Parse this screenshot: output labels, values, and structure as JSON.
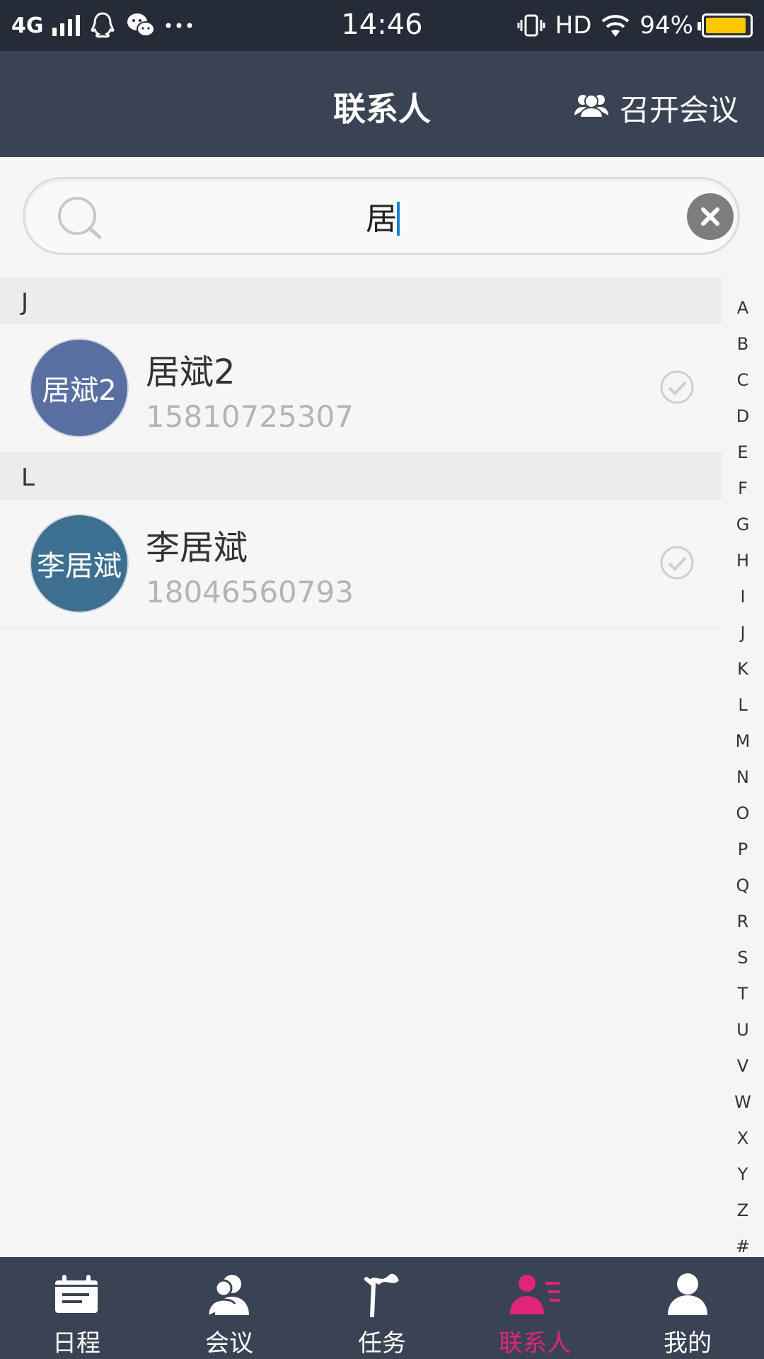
{
  "status_bar": {
    "network": "4G",
    "time": "14:46",
    "hd": "HD",
    "battery": "94%",
    "battery_level": 0.94,
    "battery_color": "#ffc800"
  },
  "nav": {
    "title": "联系人",
    "action_label": "召开会议",
    "action_icon": "group-icon"
  },
  "search": {
    "value": "居",
    "placeholder": ""
  },
  "sections": [
    {
      "letter": "J",
      "contacts": [
        {
          "avatar_text": "居斌2",
          "avatar_color": "#5a6fa1",
          "name": "居斌2",
          "phone": "15810725307"
        }
      ]
    },
    {
      "letter": "L",
      "contacts": [
        {
          "avatar_text": "李居斌",
          "avatar_color": "#3d6f91",
          "name": "李居斌",
          "phone": "18046560793"
        }
      ]
    }
  ],
  "alphabet": [
    "A",
    "B",
    "C",
    "D",
    "E",
    "F",
    "G",
    "H",
    "I",
    "J",
    "K",
    "L",
    "M",
    "N",
    "O",
    "P",
    "Q",
    "R",
    "S",
    "T",
    "U",
    "V",
    "W",
    "X",
    "Y",
    "Z",
    "#"
  ],
  "tabs": [
    {
      "label": "日程",
      "icon": "calendar-icon",
      "active": false
    },
    {
      "label": "会议",
      "icon": "meeting-icon",
      "active": false
    },
    {
      "label": "任务",
      "icon": "flag-icon",
      "active": false
    },
    {
      "label": "联系人",
      "icon": "contacts-icon",
      "active": true
    },
    {
      "label": "我的",
      "icon": "person-icon",
      "active": false
    }
  ],
  "colors": {
    "nav_bg": "#394353",
    "status_bg": "#262c37",
    "active_tab": "#e0247a"
  }
}
